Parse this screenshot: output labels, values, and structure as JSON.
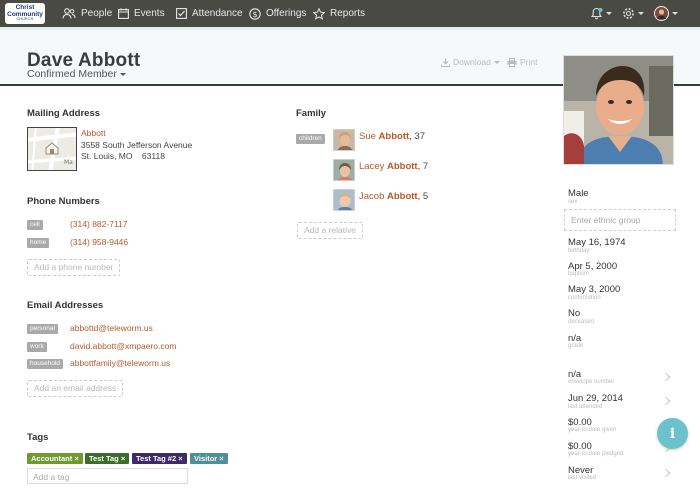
{
  "logo": {
    "line1": "Christ",
    "line2": "Community",
    "line3": "CHURCH"
  },
  "nav": {
    "items": [
      {
        "label": "People",
        "icon": "people-icon"
      },
      {
        "label": "Events",
        "icon": "calendar-icon"
      },
      {
        "label": "Attendance",
        "icon": "checkbox-icon"
      },
      {
        "label": "Offerings",
        "icon": "dollar-icon"
      },
      {
        "label": "Reports",
        "icon": "star-icon"
      }
    ],
    "right": [
      "bell-icon",
      "gear-icon",
      "user-avatar"
    ]
  },
  "person": {
    "name": "Dave Abbott",
    "status": "Confirmed Member"
  },
  "actions": {
    "download": "Download",
    "print": "Print"
  },
  "mailing": {
    "title": "Mailing Address",
    "name": "Abbott",
    "street": "3558 South Jefferson Avenue",
    "city": "St. Louis, MO    63118"
  },
  "phones": {
    "title": "Phone Numbers",
    "items": [
      {
        "type": "cell",
        "value": "(314) 882-7117"
      },
      {
        "type": "home",
        "value": "(314) 958-9446"
      }
    ],
    "add": "Add a phone number"
  },
  "emails": {
    "title": "Email Addresses",
    "items": [
      {
        "type": "personal",
        "value": "abbottd@teleworm.us"
      },
      {
        "type": "work",
        "value": "david.abbott@xmpaero.com"
      },
      {
        "type": "household",
        "value": "abbottfamily@teleworm.us"
      }
    ],
    "add": "Add an email address"
  },
  "tags": {
    "title": "Tags",
    "items": [
      {
        "label": "Accountant",
        "color": "#6f9a2f"
      },
      {
        "label": "Test Tag",
        "color": "#3b6e2a"
      },
      {
        "label": "Test Tag #2",
        "color": "#3d2a6a"
      },
      {
        "label": "Visitor",
        "color": "#4e8f9b"
      }
    ],
    "remove_glyph": "×",
    "placeholder": "Add a tag"
  },
  "family": {
    "title": "Family",
    "group_label": "children",
    "members": [
      {
        "first": "Sue",
        "last": "Abbott",
        "age": ", 37"
      },
      {
        "first": "Lacey",
        "last": "Abbott",
        "age": ", 7"
      },
      {
        "first": "Jacob",
        "last": "Abbott",
        "age": ", 5"
      }
    ],
    "add": "Add a relative"
  },
  "details": {
    "sex": {
      "value": "Male",
      "label": "sex"
    },
    "ethnic_placeholder": "Enter ethnic group",
    "birthday": {
      "value": "May 16, 1974",
      "label": "birthday"
    },
    "baptism": {
      "value": "Apr 5, 2000",
      "label": "baptism"
    },
    "confirmation": {
      "value": "May 3, 2000",
      "label": "confirmation"
    },
    "deceased": {
      "value": "No",
      "label": "deceased"
    },
    "grade": {
      "value": "n/a",
      "label": "grade"
    },
    "envelope": {
      "value": "n/a",
      "label": "envelope number"
    },
    "last_attended": {
      "value": "Jun 29, 2014",
      "label": "last attended"
    },
    "ytd_given": {
      "value": "$0.00",
      "label": "year-to-date given"
    },
    "ytd_pledged": {
      "value": "$0.00",
      "label": "year-to-date pledged"
    },
    "last_visited": {
      "value": "Never",
      "label": "last visited"
    }
  },
  "fab": "i"
}
